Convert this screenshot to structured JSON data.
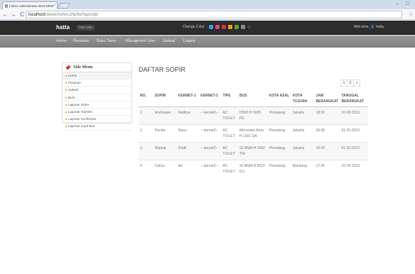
{
  "browser": {
    "tab_title": "[ Sites Administrator BUS DEW",
    "tab_close": "×",
    "window_controls": "‒ ☐",
    "back": "←",
    "forward": "→",
    "reload": "C",
    "url_host": "localhost",
    "url_path": "/dewe/index.php/be/lapsopir",
    "star": "☆"
  },
  "topbar": {
    "brand": "hatta",
    "view_site": "View Site",
    "change_color_label": "Change Color",
    "swatches": [
      "#31a6d9",
      "#e0447e",
      "#c43d3d",
      "#f1a10f",
      "#55a83b",
      "#8a8a8a",
      "#3f3f3f"
    ],
    "welcome": "Welcome, 👤 hatta"
  },
  "menu": [
    "Home",
    "Pesanan",
    "Buku Tamu",
    "Manajemen User",
    "Jadwal",
    "Logout"
  ],
  "sidebar": {
    "title": "Side Menu",
    "items": [
      "Home",
      "Pesanan",
      "Jadwal",
      "BUS",
      "Laporan Order",
      "Laporan Transfer",
      "Laporan Konfirmasi",
      "Laporan Sopir Bus"
    ]
  },
  "main": {
    "title": "DAFTAR SOPIR",
    "pager": [
      "1",
      "2",
      "»"
    ]
  },
  "table": {
    "headers": [
      "NO.",
      "SOPIR",
      "KERNET-1",
      "KERNET-2",
      "TIPE",
      "BUS",
      "KOTA ASAL",
      "KOTA TUJUAN",
      "JAM BERANGKAT",
      "TANGGAL BERANGKAT"
    ],
    "rows": [
      [
        "1.",
        "Endrawan",
        "Raditya",
        "-- kernet2--",
        "AC TOILET",
        "HINO H 5935 PE",
        "Pemalang",
        "Jakarta",
        "18:15",
        "10-02-2013"
      ],
      [
        "2.",
        "Deckie",
        "Ranu",
        "-- kernet2--",
        "AC TOILET",
        "Mercedes Benz H 1001 GA",
        "Pemalang",
        "Jakarta",
        "06:45",
        "01-01-2013"
      ],
      [
        "3.",
        "Ndolop",
        "Dadit",
        "-- kernet2--",
        "AC TOILET",
        "SCANIA H 2492 TW",
        "Pemalang",
        "Jakarta",
        "10:30",
        "01-02-2013"
      ],
      [
        "4.",
        "Cahyo",
        "Ari",
        "-- kernet2--",
        "AC TOILET",
        "SCANIA B 9519 KU",
        "Pemalang",
        "Bandung",
        "17:30",
        "10-02-2013"
      ]
    ]
  }
}
